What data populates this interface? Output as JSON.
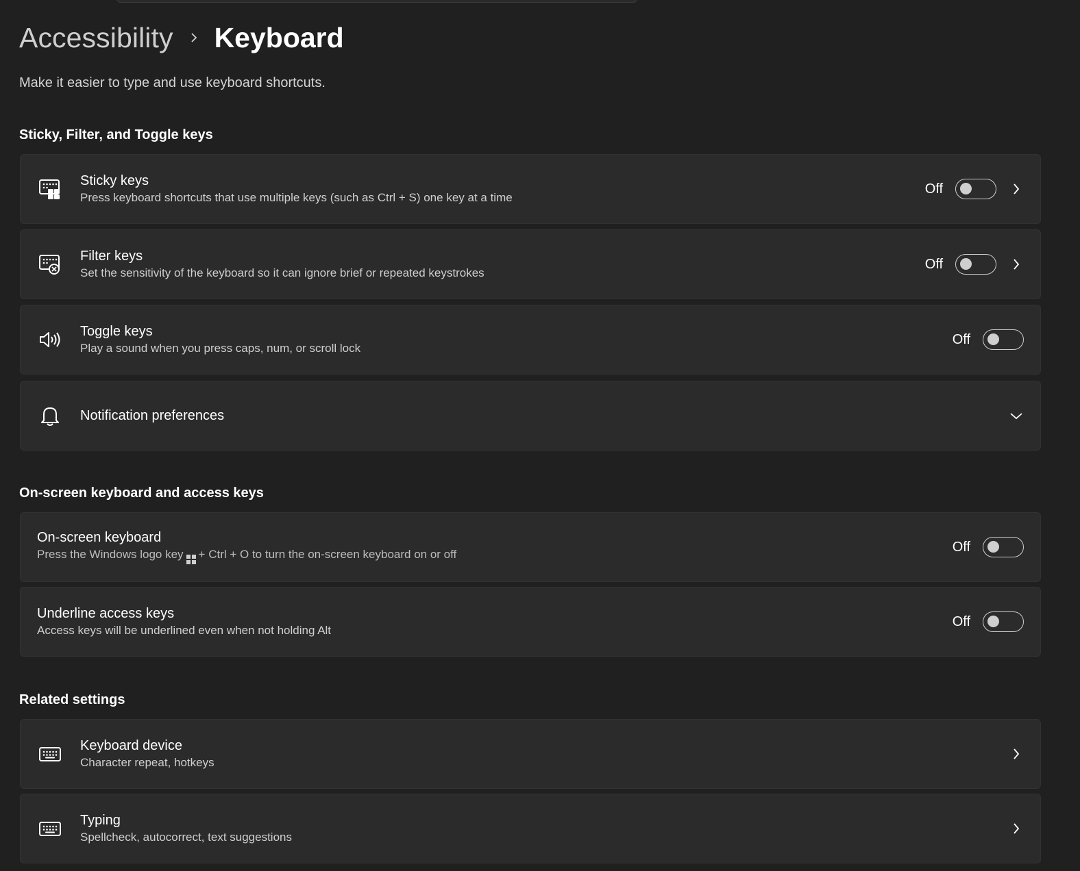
{
  "breadcrumb": {
    "parent": "Accessibility",
    "current": "Keyboard"
  },
  "page_description": "Make it easier to type and use keyboard shortcuts.",
  "sections": {
    "sticky_filter_toggle": {
      "title": "Sticky, Filter, and Toggle keys",
      "items": [
        {
          "title": "Sticky keys",
          "subtitle": "Press keyboard shortcuts that use multiple keys (such as Ctrl + S) one key at a time",
          "state": "Off",
          "icon": "sticky-keys-icon"
        },
        {
          "title": "Filter keys",
          "subtitle": "Set the sensitivity of the keyboard so it can ignore brief or repeated keystrokes",
          "state": "Off",
          "icon": "filter-keys-icon"
        },
        {
          "title": "Toggle keys",
          "subtitle": "Play a sound when you press caps, num, or scroll lock",
          "state": "Off",
          "icon": "speaker-icon"
        },
        {
          "title": "Notification preferences",
          "icon": "bell-icon"
        }
      ]
    },
    "onscreen_access": {
      "title": "On-screen keyboard and access keys",
      "items": [
        {
          "title": "On-screen keyboard",
          "subtitle_before": "Press the Windows logo key",
          "subtitle_after": "+ Ctrl + O to turn the on-screen keyboard on or off",
          "state": "Off"
        },
        {
          "title": "Underline access keys",
          "subtitle": "Access keys will be underlined even when not holding Alt",
          "state": "Off"
        }
      ]
    },
    "related": {
      "title": "Related settings",
      "items": [
        {
          "title": "Keyboard device",
          "subtitle": "Character repeat, hotkeys",
          "icon": "keyboard-icon"
        },
        {
          "title": "Typing",
          "subtitle": "Spellcheck, autocorrect, text suggestions",
          "icon": "keyboard-icon"
        }
      ]
    }
  },
  "colors": {
    "background": "#202020",
    "card": "#2b2b2b",
    "text_primary": "#ffffff",
    "text_secondary": "#cfcfcf"
  }
}
